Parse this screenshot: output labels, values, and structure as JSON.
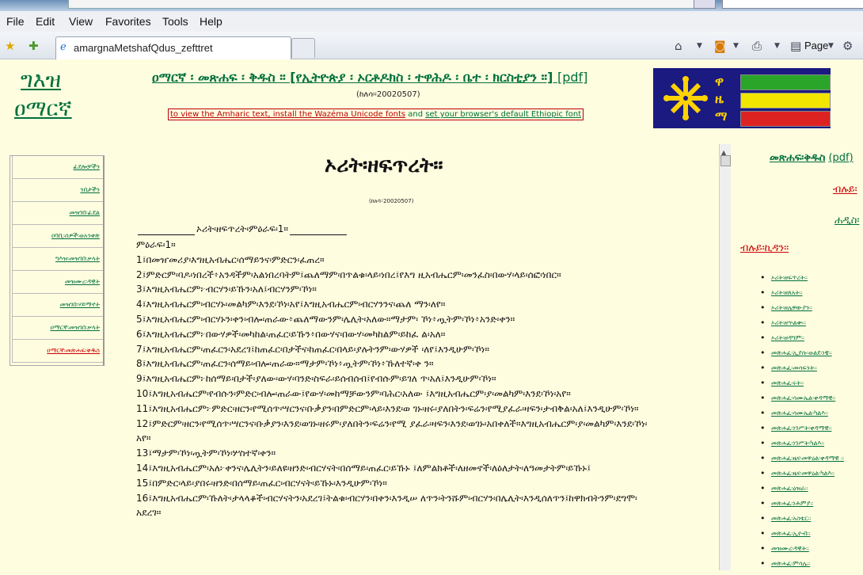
{
  "browser": {
    "menu": [
      "File",
      "Edit",
      "View",
      "Favorites",
      "Tools",
      "Help"
    ],
    "tab_title": "amargnaMetshafQdus_zefttret",
    "page_label": "Page"
  },
  "header": {
    "logo_line1": "ግእዝ",
    "logo_line2": "ዐማርኛ",
    "title": "ዐማርኛ ፡ መጽሐፍ ፡ ቅዱስ ። [የኢትዮጵያ ፡ ኦርቶዶክስ ፡ ተዋሕዶ ፡ ቤተ ፡ ክርስቲያን ።]",
    "pdf": "[pdf]",
    "date": "(ከለሳ።20020507)",
    "note_link1": "to view the Amharic text, install the Wazéma Unicode fonts",
    "note_and": "and",
    "note_link2": "set your browser's default Ethiopic font",
    "flag_letters": [
      "ዋ",
      "ዜ",
      "ማ"
    ],
    "flag_colors": [
      "#2aa52a",
      "#f2e600",
      "#dd2222"
    ]
  },
  "left_nav": [
    {
      "label": "ፊደሎቻችን",
      "active": false
    },
    {
      "label": "ንበታችን",
      "active": false
    },
    {
      "label": "መዝገበ፡ፊደል",
      "active": false
    },
    {
      "label": "ዐባቢ፡ሰዎች፡ወአንቀጽ",
      "active": false
    },
    {
      "label": "ግእዝ፡መዝገበ፡ቃላት",
      "active": false
    },
    {
      "label": "መዝሙረ፡ዳዊት",
      "active": false
    },
    {
      "label": "መዝገበ፡ሃይማኖት",
      "active": false
    },
    {
      "label": "ዐማርኛ፡መዝገበ፡ቃላት",
      "active": false
    },
    {
      "label": "ዐማርኛ፡መጽሐፍ፡ቅዱስ",
      "active": true
    }
  ],
  "main": {
    "title": "ኦሪት፡ዘፍጥረት።",
    "date": "(ከለሳ።20020507)",
    "chapter_heading": "ኦሪት፡ዘፍጥረት፡ምዕራፍ፡1።",
    "chapter_label": "ምዕራፍ፡1።",
    "verses": [
      "1፤በመዠመሪያ፡እግዚአብሔር፡ሰማይንና፡ምድርን፡ፈጠረ።",
      "2፤ምድርም፡ባዶ፡ነበረች፥አንዳችም፡አልነበረባትም፤ጨለማም፡በጥልቁ፡ላይ፡ነበረ፤የእግ ዚአብሔርም፡መንፈስ፡በውሃ፡ላይ፡ሰፎ፡ነበር።",
      "3፤እግዚአብሔርም፦ብርሃን፡ይኹን፡አለ፤ብርሃንም፡ኾነ።",
      "4፤እግዚአብሔርም፡ብርሃኑ፡መልካም፡እንደ፡ኾነ፡አየ፤እግዚአብሔርም፡ብርሃንንና፡ጨለ ማን፡ለየ።",
      "5፤እግዚአብሔርም፡ብርሃኑን፡ቀን፡ብሎ፡ጠራው፥ጨለማውንም፡ሌሊት፡አለው።ማታም፡ ኾነ፥ጧትም፡ኾነ፥አንድ፡ቀን።",
      "6፤እግዚአብሔርም፦በውሃዎች፡መካከል፡ጠፈር፡ይኹን፥በውሃና፡በውሃ፡መካከልም፡ይከፈ ል፡አለ።",
      "7፤እግዚአብሔርም፡ጠፈርን፡አደረገ፤ከጠፈር፡በታችና፡ከጠፈር፡በላይ፡ያሉትንም፡ውሃዎች ፡ለየ፤እንዲሁም፡ኾነ።",
      "8፤እግዚአብሔርም፡ጠፈርን፡ሰማይ፡ብሎ፡ጠራው።ማታም፡ኾነ፥ጧትም፡ኾነ፥ኹለተኛ፡ቀ ን።",
      "9፤እግዚአብሔርም፦ከሰማይ፡በታች፡ያለው፡ውሃ፡ባንድ፡ስፍራ፡ይሰብሰብ፤የብሱም፡ይገለ ጥ፡አለ፤እንዲሁም፡ኾነ።",
      "10፤እግዚአብሔርም፡የብሱን፡ምድር፡ብሎ፡ጠራው፤የውሃ፡መከማቻውንም፡ባሕር፡አለው ፤እግዚአብሔርም፡ያ፡መልካም፡እንደ፡ኾነ፡አየ።",
      "11፤እግዚአብሔርም፦ምድር፡ዘርን፡የሚሰጥ፡ሣርንና፡ቡቃያን፡በምድርም፡ላይ፡እንደ፡ወ ገኑ፡ዘሩ፡ያለበትን፡ፍሬን፡የሚያፈራ፡ዛፍን፡ታብቅል፡አለ፤እንዲሁም፡ኾነ።",
      "12፤ምድርም፡ዘርን፡የሚሰጥ፡ሣርንና፡ቡቃያን፡እንደ፡ወገኑ፡ዘሩም፡ያለበትን፡ፍሬን፡የሚ ያፈራ፡ዛፍን፡እንደ፡ወገኑ፡አበቀለች።እግዚአብሔርም፡ያ፡መልካም፡እንደ፡ኾነ፡አየ።",
      "13፤ማታም፡ኾነ፡ጧትም፡ኾነ፡ሦስተኛ፡ቀን።",
      "14፤እግዚአብሔርም፡አለ፦ቀንና፡ሌሊትን፡ይለዩ፡ዘንድ፡ብርሃናት፡በሰማይ፡ጠፈር፡ይኹኑ ፤ለምልክቶች፡ለዘመኖች፡ለዕለታት፡ለዓመታትም፡ይኹኑ፤",
      "15፤በምድር፡ላይ፡ያበሩ፡ዘንድ፡በሰማይ፡ጠፈር፡ብርሃናት፡ይኹኑ፡እንዲሁም፡ኾነ።",
      "16፤እግዚአብሔርም፡ኹለት፡ታላላቆች፡ብርሃናትን፡አደረገ፤ትልቁ፡ብርሃን፡በቀን፡እንዲሠ ለጥን፡ትንሹም፡ብርሃን፡በሌሊት፡እንዲሰለጥን፤ከዋክብትንም፡ደግሞ፡አደረገ።"
    ]
  },
  "right": {
    "title": "መጽሐፍ፡ቅዱስ",
    "pdf": "(pdf)",
    "link1": "ብሉይ፡",
    "link2": "ሐዲስ፡",
    "section": "ብሉይ፡ኪዳን።",
    "books": [
      "ኦሪት፡ዘፍጥረት።",
      "ኦሪት፡ዘጸአት።",
      "ኦሪት፡ዘሌዋውያን።",
      "ኦሪት፡ዘኍልቍ።",
      "ኦሪት፡ዘዳግም።",
      "መጽሐፈ፡ኢያሱ፡ወልደ፡ነዌ።",
      "መጽሐፈ፡መሳፍንት።",
      "መጽሐፈ፡ሩት።",
      "መጽሐፈ፡ሳሙኤል፡ቀዳማዊ።",
      "መጽሐፈ፡ሳሙኤል፡ካልእ።",
      "መጽሐፈ፡ነገሥት፡ቀዳማዊ።",
      "መጽሐፈ፡ነገሥት፡ካልእ።",
      "መጽሐፈ፡ዜና፡መዋዕል፡ቀዳማዊ ።",
      "መጽሐፈ፡ዜና፡መዋዕል፡ካልእ።",
      "መጽሐፈ፡ዕዝራ።",
      "መጽሐፈ፡ነሕምያ።",
      "መጽሐፈ፡አስቴር።",
      "መጽሐፈ፡ኢዮብ።",
      "መዝሙረ፡ዳዊት።",
      "መጽሐፈ፡ምሳሌ።"
    ]
  }
}
